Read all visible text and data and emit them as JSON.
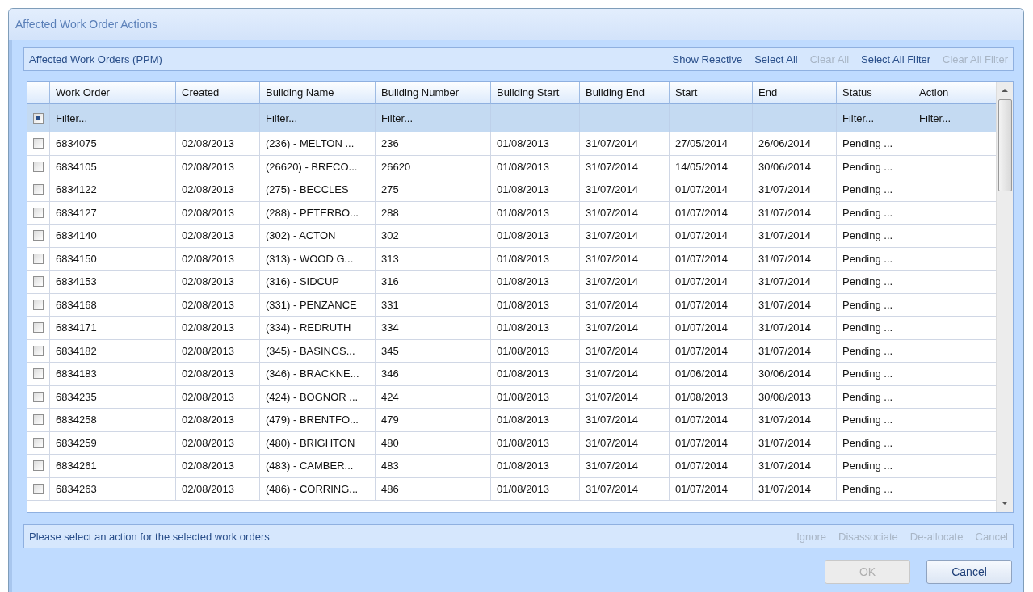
{
  "window": {
    "title": "Affected Work Order Actions"
  },
  "toolbar": {
    "title": "Affected Work Orders (PPM)",
    "links": [
      {
        "label": "Show Reactive",
        "disabled": false
      },
      {
        "label": "Select All",
        "disabled": false
      },
      {
        "label": "Clear All",
        "disabled": true
      },
      {
        "label": "Select All Filter",
        "disabled": false
      },
      {
        "label": "Clear All Filter",
        "disabled": true
      }
    ]
  },
  "table": {
    "select_all": {
      "partial": true
    },
    "columns": [
      {
        "label": "Work Order",
        "filter": "Filter..."
      },
      {
        "label": "Created"
      },
      {
        "label": "Building Name",
        "filter": "Filter..."
      },
      {
        "label": "Building Number",
        "filter": "Filter..."
      },
      {
        "label": "Building Start"
      },
      {
        "label": "Building End"
      },
      {
        "label": "Start"
      },
      {
        "label": "End"
      },
      {
        "label": "Status",
        "filter": "Filter..."
      },
      {
        "label": "Action",
        "filter": "Filter..."
      }
    ],
    "rows": [
      {
        "checked": false,
        "cells": [
          "6834075",
          "02/08/2013",
          "(236) - MELTON ...",
          "236",
          "01/08/2013",
          "31/07/2014",
          "27/05/2014",
          "26/06/2014",
          "Pending ..."
        ]
      },
      {
        "checked": false,
        "cells": [
          "6834105",
          "02/08/2013",
          "(26620) - BRECO...",
          "26620",
          "01/08/2013",
          "31/07/2014",
          "14/05/2014",
          "30/06/2014",
          "Pending ..."
        ]
      },
      {
        "checked": false,
        "cells": [
          "6834122",
          "02/08/2013",
          "(275) - BECCLES",
          "275",
          "01/08/2013",
          "31/07/2014",
          "01/07/2014",
          "31/07/2014",
          "Pending ..."
        ]
      },
      {
        "checked": false,
        "cells": [
          "6834127",
          "02/08/2013",
          "(288) - PETERBO...",
          "288",
          "01/08/2013",
          "31/07/2014",
          "01/07/2014",
          "31/07/2014",
          "Pending ..."
        ]
      },
      {
        "checked": false,
        "cells": [
          "6834140",
          "02/08/2013",
          "(302) - ACTON",
          "302",
          "01/08/2013",
          "31/07/2014",
          "01/07/2014",
          "31/07/2014",
          "Pending ..."
        ]
      },
      {
        "checked": false,
        "cells": [
          "6834150",
          "02/08/2013",
          "(313) - WOOD G...",
          "313",
          "01/08/2013",
          "31/07/2014",
          "01/07/2014",
          "31/07/2014",
          "Pending ..."
        ]
      },
      {
        "checked": false,
        "cells": [
          "6834153",
          "02/08/2013",
          "(316) - SIDCUP",
          "316",
          "01/08/2013",
          "31/07/2014",
          "01/07/2014",
          "31/07/2014",
          "Pending ..."
        ]
      },
      {
        "checked": false,
        "cells": [
          "6834168",
          "02/08/2013",
          "(331) - PENZANCE",
          "331",
          "01/08/2013",
          "31/07/2014",
          "01/07/2014",
          "31/07/2014",
          "Pending ..."
        ]
      },
      {
        "checked": false,
        "cells": [
          "6834171",
          "02/08/2013",
          "(334) - REDRUTH",
          "334",
          "01/08/2013",
          "31/07/2014",
          "01/07/2014",
          "31/07/2014",
          "Pending ..."
        ]
      },
      {
        "checked": false,
        "cells": [
          "6834182",
          "02/08/2013",
          "(345) - BASINGS...",
          "345",
          "01/08/2013",
          "31/07/2014",
          "01/07/2014",
          "31/07/2014",
          "Pending ..."
        ]
      },
      {
        "checked": false,
        "cells": [
          "6834183",
          "02/08/2013",
          "(346) - BRACKNE...",
          "346",
          "01/08/2013",
          "31/07/2014",
          "01/06/2014",
          "30/06/2014",
          "Pending ..."
        ]
      },
      {
        "checked": false,
        "cells": [
          "6834235",
          "02/08/2013",
          "(424) - BOGNOR ...",
          "424",
          "01/08/2013",
          "31/07/2014",
          "01/08/2013",
          "30/08/2013",
          "Pending ..."
        ]
      },
      {
        "checked": false,
        "cells": [
          "6834258",
          "02/08/2013",
          "(479) - BRENTFO...",
          "479",
          "01/08/2013",
          "31/07/2014",
          "01/07/2014",
          "31/07/2014",
          "Pending ..."
        ]
      },
      {
        "checked": false,
        "cells": [
          "6834259",
          "02/08/2013",
          "(480) - BRIGHTON",
          "480",
          "01/08/2013",
          "31/07/2014",
          "01/07/2014",
          "31/07/2014",
          "Pending ..."
        ]
      },
      {
        "checked": false,
        "cells": [
          "6834261",
          "02/08/2013",
          "(483) - CAMBER...",
          "483",
          "01/08/2013",
          "31/07/2014",
          "01/07/2014",
          "31/07/2014",
          "Pending ..."
        ]
      },
      {
        "checked": false,
        "cells": [
          "6834263",
          "02/08/2013",
          "(486) - CORRING...",
          "486",
          "01/08/2013",
          "31/07/2014",
          "01/07/2014",
          "31/07/2014",
          "Pending ..."
        ]
      }
    ]
  },
  "status_bar": {
    "message": "Please select an action for the selected work orders",
    "actions": [
      {
        "label": "Ignore",
        "disabled": true
      },
      {
        "label": "Disassociate",
        "disabled": true
      },
      {
        "label": "De-allocate",
        "disabled": true
      },
      {
        "label": "Cancel",
        "disabled": true
      }
    ]
  },
  "buttons": [
    {
      "label": "OK",
      "disabled": true
    },
    {
      "label": "Cancel",
      "disabled": false
    }
  ]
}
